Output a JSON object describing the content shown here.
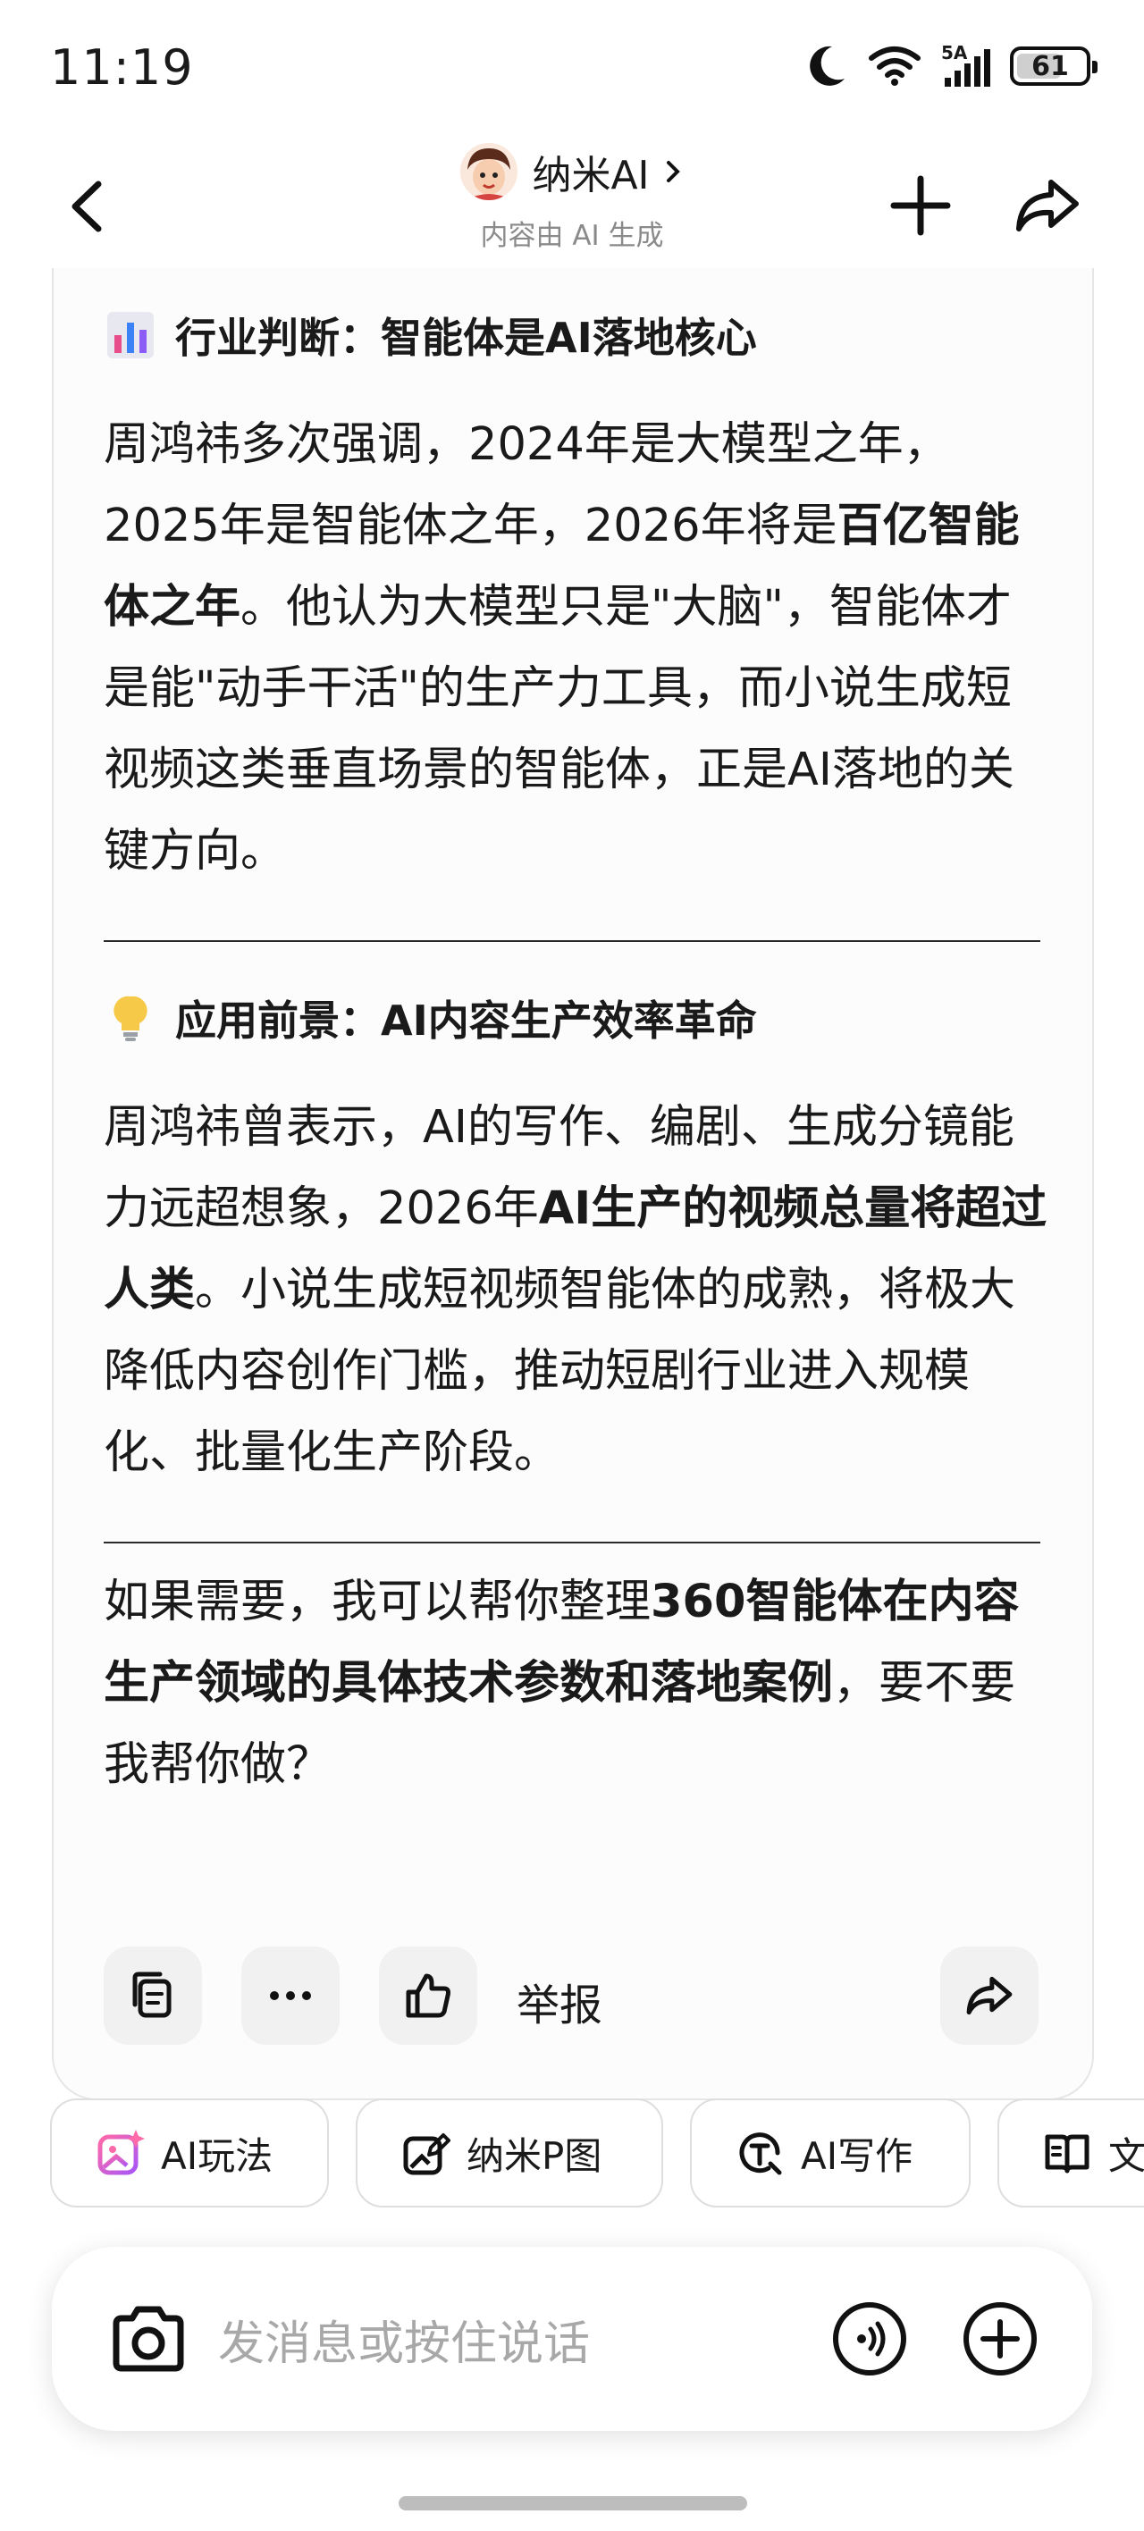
{
  "status_bar": {
    "time": "11:19",
    "battery": "61",
    "network": "5A"
  },
  "header": {
    "title": "纳米AI",
    "subtitle": "内容由 AI 生成"
  },
  "sections": [
    {
      "title": "行业判断：智能体是AI落地核心",
      "para": [
        {
          "t": "周鸿祎多次强调，2024年是大模型之年，2025年是智能体之年，2026年将是",
          "b": false
        },
        {
          "t": "百亿智能体之年",
          "b": true
        },
        {
          "t": "。他认为大模型只是\"大脑\"，智能体才是能\"动手干活\"的生产力工具，而小说生成短视频这类垂直场景的智能体，正是AI落地的关键方向。",
          "b": false
        }
      ]
    },
    {
      "title": "应用前景：AI内容生产效率革命",
      "para": [
        {
          "t": "周鸿祎曾表示，AI的写作、编剧、生成分镜能力远超想象，2026年",
          "b": false
        },
        {
          "t": "AI生产的视频总量将超过人类",
          "b": true
        },
        {
          "t": "。小说生成短视频智能体的成熟，将极大降低内容创作门槛，推动短剧行业进入规模化、批量化生产阶段。",
          "b": false
        }
      ]
    }
  ],
  "closing": [
    {
      "t": "如果需要，我可以帮你整理",
      "b": false
    },
    {
      "t": "360智能体在内容生产领域的具体技术参数和落地案例",
      "b": true
    },
    {
      "t": "，要不要我帮你做？",
      "b": false
    }
  ],
  "actions": {
    "report_label": "举报"
  },
  "chips": [
    {
      "label": "AI玩法",
      "icon": "sparkle-image-icon"
    },
    {
      "label": "纳米P图",
      "icon": "edit-image-icon"
    },
    {
      "label": "AI写作",
      "icon": "ai-write-icon"
    },
    {
      "label": "文",
      "icon": "book-icon"
    }
  ],
  "input": {
    "placeholder": "发消息或按住说话"
  },
  "colors": {
    "chip_accent": "#e040a0",
    "divider": "#2a2a2a",
    "muted": "#8a8a8a"
  }
}
